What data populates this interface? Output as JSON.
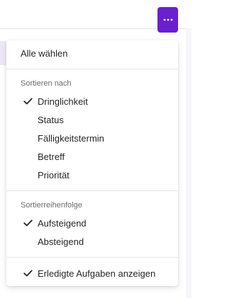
{
  "colors": {
    "accent": "#6a1fd0",
    "text": "#262626",
    "muted": "#6b6b6b"
  },
  "more_button": {
    "icon": "more-horizontal-icon"
  },
  "menu": {
    "select_all": "Alle wählen",
    "sort_by": {
      "header": "Sortieren nach",
      "items": [
        {
          "label": "Dringlichkeit",
          "checked": true
        },
        {
          "label": "Status",
          "checked": false
        },
        {
          "label": "Fälligkeitstermin",
          "checked": false
        },
        {
          "label": "Betreff",
          "checked": false
        },
        {
          "label": "Priorität",
          "checked": false
        }
      ]
    },
    "sort_order": {
      "header": "Sortierreihenfolge",
      "items": [
        {
          "label": "Aufsteigend",
          "checked": true
        },
        {
          "label": "Absteigend",
          "checked": false
        }
      ]
    },
    "show_completed": {
      "label": "Erledigte Aufgaben anzeigen",
      "checked": true
    },
    "check_icon": "checkmark-icon"
  }
}
